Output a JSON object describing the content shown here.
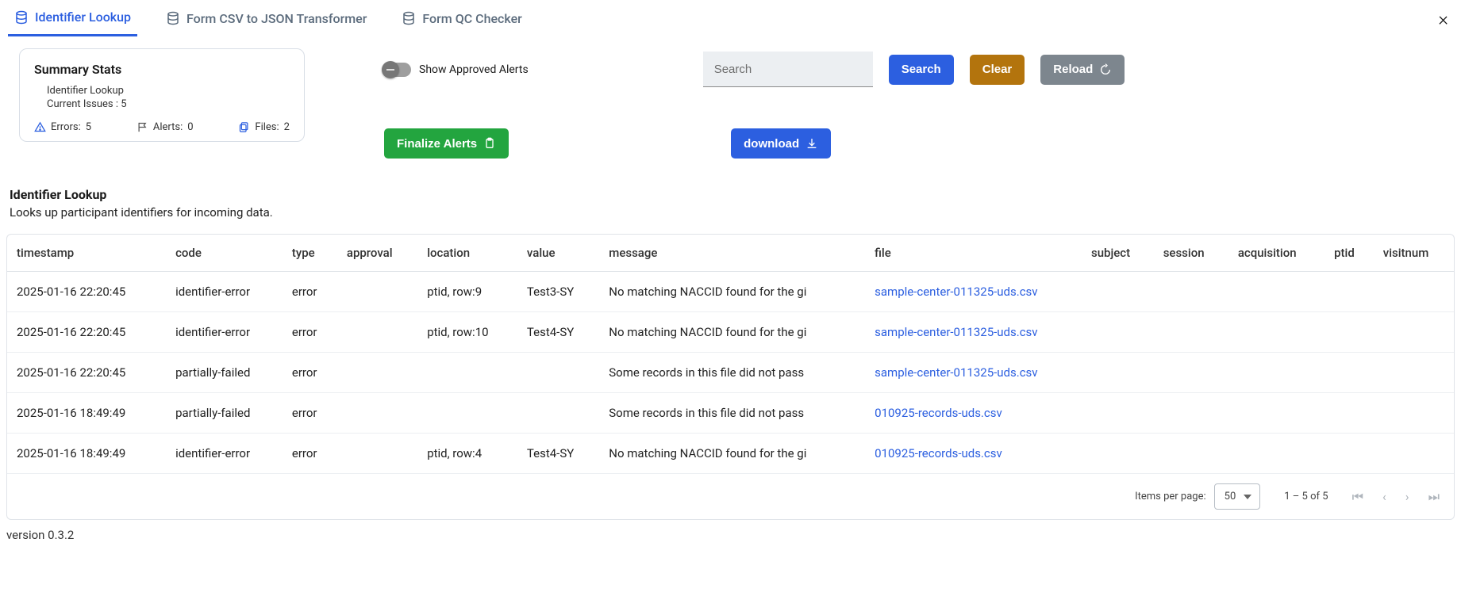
{
  "close_icon": "×",
  "tabs": [
    {
      "label": "Identifier Lookup"
    },
    {
      "label": "Form CSV to JSON Transformer"
    },
    {
      "label": "Form QC Checker"
    }
  ],
  "summary": {
    "title": "Summary Stats",
    "subtitle": "Identifier Lookup",
    "issues_line": "Current Issues : 5",
    "errors_label": "Errors:",
    "errors_count": "5",
    "alerts_label": "Alerts:",
    "alerts_count": "0",
    "files_label": "Files:",
    "files_count": "2"
  },
  "controls": {
    "toggle_label": "Show Approved Alerts",
    "search_placeholder": "Search",
    "search_btn": "Search",
    "clear_btn": "Clear",
    "reload_btn": "Reload",
    "finalize_btn": "Finalize Alerts",
    "download_btn": "download"
  },
  "section": {
    "title": "Identifier Lookup",
    "description": "Looks up participant identifiers for incoming data."
  },
  "table": {
    "headers": [
      "timestamp",
      "code",
      "type",
      "approval",
      "location",
      "value",
      "message",
      "file",
      "subject",
      "session",
      "acquisition",
      "ptid",
      "visitnum"
    ],
    "rows": [
      {
        "timestamp": "2025-01-16 22:20:45",
        "code": "identifier-error",
        "type": "error",
        "approval": "",
        "location": "ptid, row:9",
        "value": "Test3-SY",
        "message": "No matching NACCID found for the gi",
        "file": "sample-center-011325-uds.csv",
        "subject": "",
        "session": "",
        "acquisition": "",
        "ptid": "",
        "visitnum": ""
      },
      {
        "timestamp": "2025-01-16 22:20:45",
        "code": "identifier-error",
        "type": "error",
        "approval": "",
        "location": "ptid, row:10",
        "value": "Test4-SY",
        "message": "No matching NACCID found for the gi",
        "file": "sample-center-011325-uds.csv",
        "subject": "",
        "session": "",
        "acquisition": "",
        "ptid": "",
        "visitnum": ""
      },
      {
        "timestamp": "2025-01-16 22:20:45",
        "code": "partially-failed",
        "type": "error",
        "approval": "",
        "location": "",
        "value": "",
        "message": "Some records in this file did not pass",
        "file": "sample-center-011325-uds.csv",
        "subject": "",
        "session": "",
        "acquisition": "",
        "ptid": "",
        "visitnum": ""
      },
      {
        "timestamp": "2025-01-16 18:49:49",
        "code": "partially-failed",
        "type": "error",
        "approval": "",
        "location": "",
        "value": "",
        "message": "Some records in this file did not pass",
        "file": "010925-records-uds.csv",
        "subject": "",
        "session": "",
        "acquisition": "",
        "ptid": "",
        "visitnum": ""
      },
      {
        "timestamp": "2025-01-16 18:49:49",
        "code": "identifier-error",
        "type": "error",
        "approval": "",
        "location": "ptid, row:4",
        "value": "Test4-SY",
        "message": "No matching NACCID found for the gi",
        "file": "010925-records-uds.csv",
        "subject": "",
        "session": "",
        "acquisition": "",
        "ptid": "",
        "visitnum": ""
      }
    ]
  },
  "paginator": {
    "per_page_label": "Items per page:",
    "per_page_value": "50",
    "range": "1 – 5 of 5"
  },
  "footer": {
    "version": "version 0.3.2"
  }
}
